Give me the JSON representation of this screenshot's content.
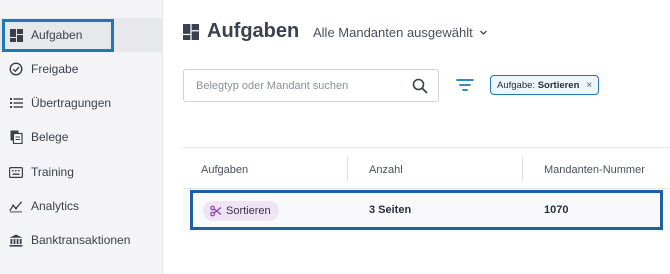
{
  "sidebar": {
    "items": [
      {
        "label": "Aufgaben",
        "icon": "dashboard-icon",
        "active": true
      },
      {
        "label": "Freigabe",
        "icon": "check-circle-icon"
      },
      {
        "label": "Übertragungen",
        "icon": "list-icon"
      },
      {
        "label": "Belege",
        "icon": "documents-icon"
      },
      {
        "label": "Training",
        "icon": "keyboard-icon"
      },
      {
        "label": "Analytics",
        "icon": "analytics-icon"
      },
      {
        "label": "Banktransaktionen",
        "icon": "bank-icon"
      }
    ]
  },
  "header": {
    "title": "Aufgaben",
    "mandant_select": "Alle Mandanten ausgewählt"
  },
  "search": {
    "placeholder": "Belegtyp oder Mandant suchen",
    "value": ""
  },
  "filter_chip": {
    "prefix": "Aufgabe:",
    "value": "Sortieren",
    "close": "×"
  },
  "table": {
    "headers": [
      "Aufgaben",
      "Anzahl",
      "Mandanten-Nummer"
    ],
    "rows": [
      {
        "task": "Sortieren",
        "count": "3 Seiten",
        "mandant_number": "1070"
      }
    ]
  },
  "colors": {
    "accent": "#1f78b4",
    "tag_bg": "#efe4f6",
    "tag_icon": "#8a3fb0"
  }
}
